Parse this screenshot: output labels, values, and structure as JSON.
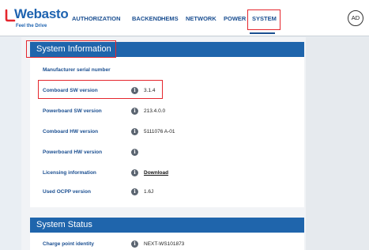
{
  "brand": {
    "name": "Webasto",
    "tagline": "Feel the Drive",
    "color": "#1e63b0"
  },
  "nav": {
    "items": [
      {
        "label": "AUTHORIZATION"
      },
      {
        "label": "BACKEND"
      },
      {
        "label": "HEMS"
      },
      {
        "label": "NETWORK"
      },
      {
        "label": "POWER"
      },
      {
        "label": "SYSTEM"
      }
    ],
    "active": "SYSTEM"
  },
  "user": {
    "initials": "AD"
  },
  "system_info": {
    "title": "System Information",
    "rows": [
      {
        "label": "Manufacturer serial number",
        "value": "",
        "has_icon": false
      },
      {
        "label": "Comboard SW version",
        "value": "3.1.4",
        "has_icon": true
      },
      {
        "label": "Powerboard SW version",
        "value": "213.4.0.0",
        "has_icon": true
      },
      {
        "label": "Comboard HW version",
        "value": "5111076 A-01",
        "has_icon": true
      },
      {
        "label": "Powerboard HW version",
        "value": "",
        "has_icon": true
      },
      {
        "label": "Licensing information",
        "value": "Download",
        "has_icon": true,
        "is_link": true
      },
      {
        "label": "Used OCPP version",
        "value": "1.6J",
        "has_icon": true
      }
    ]
  },
  "system_status": {
    "title": "System Status",
    "rows": [
      {
        "label": "Charge point identity",
        "value": "NEXT-WS101873",
        "has_icon": true
      }
    ]
  },
  "colors": {
    "header_blue": "#1f65ac",
    "highlight_red": "#e5262d",
    "label_blue": "#1b4f91"
  }
}
